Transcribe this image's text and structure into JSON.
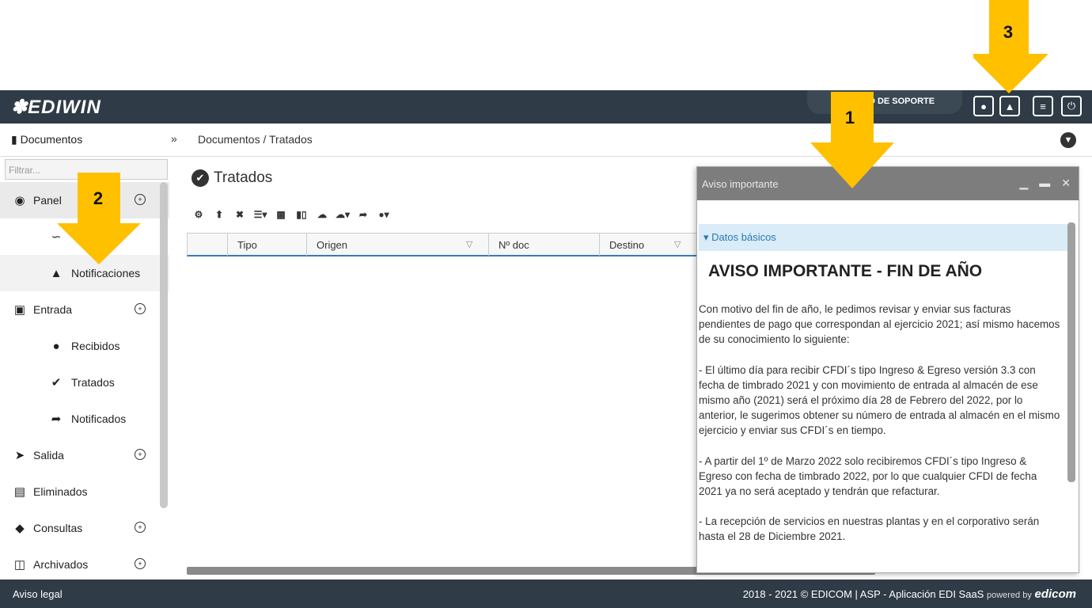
{
  "header": {
    "logo": "EDIWIN",
    "support_label": "UD DE SOPORTE",
    "buttons": [
      {
        "icon": "user-icon",
        "glyph": "☺"
      },
      {
        "icon": "bell-icon",
        "glyph": "▲"
      },
      {
        "icon": "menu-icon",
        "glyph": "≡"
      },
      {
        "icon": "power-icon",
        "glyph": "⏻"
      }
    ]
  },
  "subbar": {
    "section": "Documentos",
    "breadcrumb": "Documentos  /  Tratados"
  },
  "sidebar": {
    "filter_placeholder": "Filtrar...",
    "items": [
      {
        "label": "Panel",
        "level": 0,
        "icon": "dashboard-icon",
        "expandable": true
      },
      {
        "label": "",
        "level": 1,
        "icon": "chart-icon"
      },
      {
        "label": "Notificaciones",
        "level": 1,
        "icon": "bell-icon"
      },
      {
        "label": "Entrada",
        "level": 0,
        "icon": "inbox-icon",
        "expandable": true
      },
      {
        "label": "Recibidos",
        "level": 1,
        "icon": "exclamation-icon"
      },
      {
        "label": "Tratados",
        "level": 1,
        "icon": "check-circle-icon"
      },
      {
        "label": "Notificados",
        "level": 1,
        "icon": "share-icon"
      },
      {
        "label": "Salida",
        "level": 0,
        "icon": "paper-plane-icon",
        "expandable": true
      },
      {
        "label": "Eliminados",
        "level": 0,
        "icon": "trash-icon",
        "expandable": false
      },
      {
        "label": "Consultas",
        "level": 0,
        "icon": "binoculars-icon",
        "expandable": true
      },
      {
        "label": "Archivados",
        "level": 0,
        "icon": "database-icon",
        "expandable": true
      }
    ]
  },
  "main": {
    "title": "Tratados",
    "columns": [
      "Tipo",
      "Origen",
      "Nº doc",
      "Destino"
    ]
  },
  "modal": {
    "title": "Aviso importante",
    "tab": "Datos básicos",
    "heading": "AVISO IMPORTANTE - FIN DE AÑO",
    "paragraphs": [
      "Con motivo del fin de año, le pedimos revisar y enviar sus facturas pendientes de pago que correspondan al ejercicio 2021; así mismo hacemos de su conocimiento lo siguiente:",
      "-    El último día para recibir CFDI´s tipo Ingreso & Egreso versión 3.3 con fecha de timbrado 2021 y con movimiento de entrada al almacén de ese mismo año (2021) será el próximo día 28 de Febrero del 2022, por lo anterior,  le sugerimos obtener su número de entrada al almacén en el mismo ejercicio y enviar sus CFDI´s en tiempo.",
      "-    A partir del 1º de Marzo 2022 solo recibiremos CFDI´s tipo Ingreso & Egreso con fecha de timbrado 2022, por lo que cualquier CFDI de fecha 2021 ya no será aceptado y tendrán que refacturar.",
      "-    La recepción de servicios en nuestras plantas y en el corporativo serán hasta el 28 de Diciembre 2021."
    ]
  },
  "footer": {
    "legal": "Aviso legal",
    "copyright": "2018 - 2021 © EDICOM | ASP - Aplicación EDI SaaS",
    "powered": "powered by",
    "brand": "edicom"
  },
  "annotations": {
    "badge_1": "1",
    "badge_2": "2",
    "badge_3": "3",
    "color": "#ffc000"
  }
}
